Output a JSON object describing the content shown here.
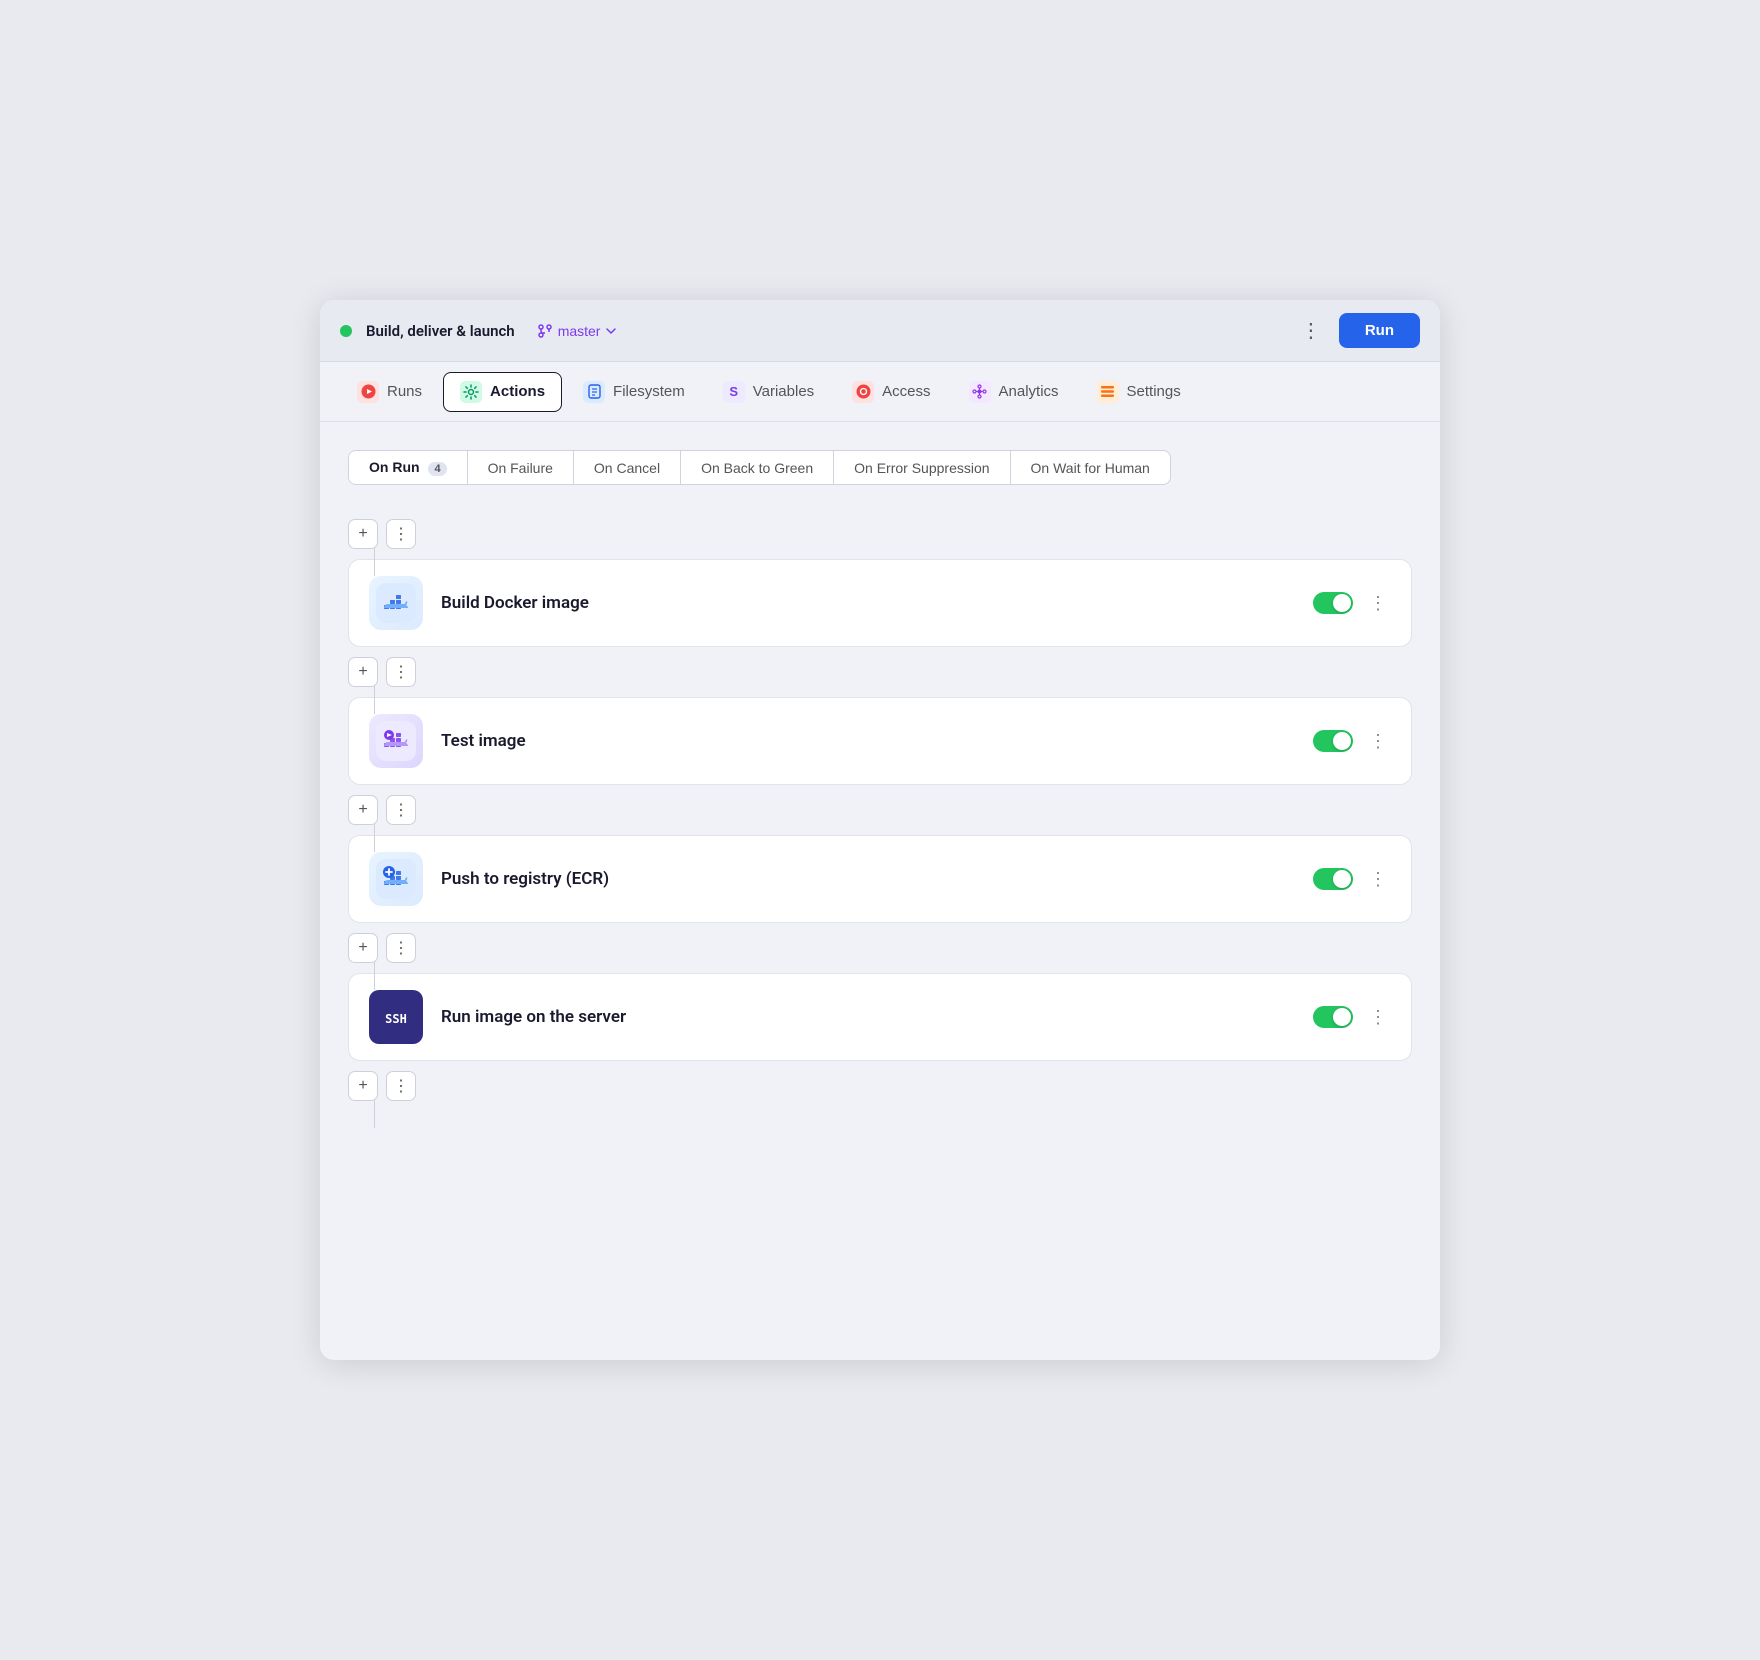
{
  "topbar": {
    "status_dot_color": "#22c55e",
    "title": "Build, deliver & launch",
    "branch": "master",
    "more_icon": "⋮",
    "run_label": "Run"
  },
  "nav_tabs": [
    {
      "id": "runs",
      "label": "Runs",
      "icon": "▶",
      "icon_bg": "#fee2e2",
      "icon_color": "#ef4444",
      "active": false
    },
    {
      "id": "actions",
      "label": "Actions",
      "icon": "⚙",
      "icon_bg": "#d1fae5",
      "icon_color": "#059669",
      "active": true
    },
    {
      "id": "filesystem",
      "label": "Filesystem",
      "icon": "📋",
      "icon_bg": "#dbeafe",
      "icon_color": "#2563eb",
      "active": false
    },
    {
      "id": "variables",
      "label": "Variables",
      "icon": "S",
      "icon_bg": "#ede9fe",
      "icon_color": "#7c3aed",
      "active": false
    },
    {
      "id": "access",
      "label": "Access",
      "icon": "🔴",
      "icon_bg": "#fee2e2",
      "icon_color": "#ef4444",
      "active": false
    },
    {
      "id": "analytics",
      "label": "Analytics",
      "icon": "◉",
      "icon_bg": "#f3e8ff",
      "icon_color": "#9333ea",
      "active": false
    },
    {
      "id": "settings",
      "label": "Settings",
      "icon": "▦",
      "icon_bg": "#ffedd5",
      "icon_color": "#f97316",
      "active": false
    }
  ],
  "sub_tabs": [
    {
      "id": "on_run",
      "label": "On Run",
      "badge": "4",
      "active": true
    },
    {
      "id": "on_failure",
      "label": "On Failure",
      "badge": null,
      "active": false
    },
    {
      "id": "on_cancel",
      "label": "On Cancel",
      "badge": null,
      "active": false
    },
    {
      "id": "on_back_to_green",
      "label": "On Back to Green",
      "badge": null,
      "active": false
    },
    {
      "id": "on_error_suppression",
      "label": "On Error Suppression",
      "badge": null,
      "active": false
    },
    {
      "id": "on_wait_for_human",
      "label": "On Wait for Human",
      "badge": null,
      "active": false
    }
  ],
  "actions": [
    {
      "id": "build_docker",
      "name": "Build Docker image",
      "icon_type": "docker_blue",
      "enabled": true
    },
    {
      "id": "test_image",
      "name": "Test image",
      "icon_type": "docker_runner",
      "enabled": true
    },
    {
      "id": "push_registry",
      "name": "Push to registry (ECR)",
      "icon_type": "docker_blue",
      "enabled": true
    },
    {
      "id": "run_server",
      "name": "Run image on the server",
      "icon_type": "ssh",
      "enabled": true
    }
  ],
  "buttons": {
    "add": "+",
    "more": "⋮"
  }
}
